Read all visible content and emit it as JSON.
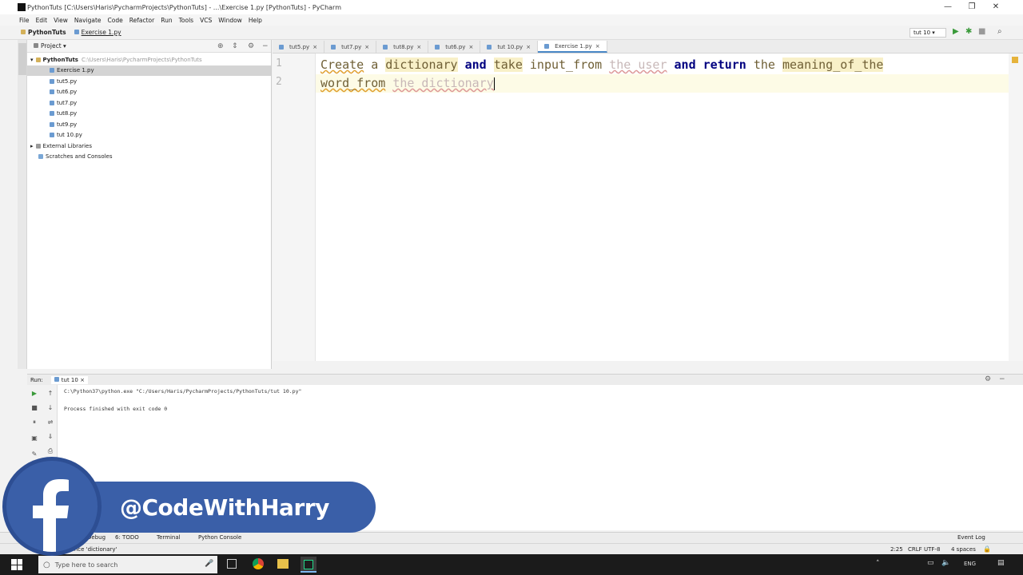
{
  "window": {
    "title": "PythonTuts [C:\\Users\\Haris\\PycharmProjects\\PythonTuts] - ...\\Exercise 1.py [PythonTuts] - PyCharm",
    "minimize": "—",
    "maximize": "❐",
    "close": "✕"
  },
  "menu": [
    "File",
    "Edit",
    "View",
    "Navigate",
    "Code",
    "Refactor",
    "Run",
    "Tools",
    "VCS",
    "Window",
    "Help"
  ],
  "nav": {
    "crumb1": "PythonTuts",
    "crumb2": "Exercise 1.py",
    "run_config": "tut 10"
  },
  "project": {
    "header": "Project",
    "root": "PythonTuts",
    "root_path": "C:\\Users\\Haris\\PycharmProjects\\PythonTuts",
    "files": [
      "Exercise 1.py",
      "tut5.py",
      "tut6.py",
      "tut7.py",
      "tut8.py",
      "tut9.py",
      "tut 10.py"
    ],
    "external": "External Libraries",
    "scratches": "Scratches and Consoles"
  },
  "tabs": [
    "tut5.py",
    "tut7.py",
    "tut8.py",
    "tut6.py",
    "tut 10.py",
    "Exercise 1.py"
  ],
  "editor": {
    "line_numbers": [
      "1",
      "2"
    ],
    "line1": {
      "w1": "Create",
      "w2": "a",
      "w3": "dictionary",
      "w4": "and",
      "w5": "take",
      "w6": "input_from",
      "w7": "the user",
      "w8": "and",
      "w9": "return",
      "w10": "the",
      "w11": "meaning_of_the"
    },
    "line2": {
      "w1": "word_from",
      "w2": "the dictionary"
    }
  },
  "run": {
    "label": "Run:",
    "tab": "tut 10",
    "cmd": "C:\\Python37\\python.exe \"C:/Users/Haris/PycharmProjects/PythonTuts/tut 10.py\"",
    "exit": "Process finished with exit code 0"
  },
  "bottom_tabs": {
    "debug": "5: Debug",
    "todo": "6: TODO",
    "terminal": "Terminal",
    "console": "Python Console",
    "event_log": "Event Log"
  },
  "status": {
    "message": "reference 'dictionary'",
    "position": "2:25",
    "crlf": "CRLF",
    "encoding": "UTF-8",
    "indent": "4 spaces"
  },
  "taskbar": {
    "search_placeholder": "Type here to search",
    "lang": "ENG"
  },
  "overlay": {
    "handle": "@CodeWithHarry"
  },
  "colors": {
    "keyword": "#000080",
    "text": "#6f5f35",
    "facebook": "#3a5fa8",
    "accent": "#4a88c7"
  }
}
